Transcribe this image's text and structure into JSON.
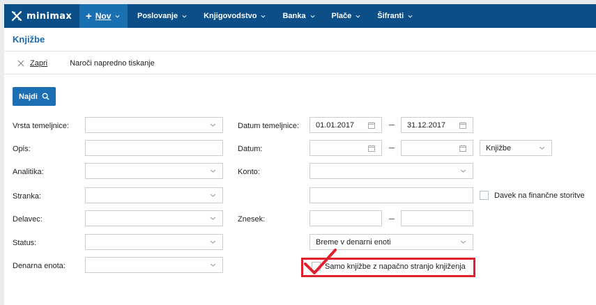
{
  "app": {
    "brand": "minimax",
    "new_label": "Nov",
    "nav": [
      "Poslovanje",
      "Knjigovodstvo",
      "Banka",
      "Plače",
      "Šifranti"
    ]
  },
  "page": {
    "title": "Knjižbe"
  },
  "toolbar": {
    "close_label": "Zapri",
    "print_label": "Naroči napredno tiskanje"
  },
  "search": {
    "find_label": "Najdi"
  },
  "form": {
    "left": [
      {
        "label": "Vrsta temeljnice:",
        "value": ""
      },
      {
        "label": "Opis:",
        "value": ""
      },
      {
        "label": "Analitika:",
        "value": ""
      },
      {
        "label": "Stranka:",
        "value": ""
      },
      {
        "label": "Delavec:",
        "value": ""
      },
      {
        "label": "Status:",
        "value": ""
      },
      {
        "label": "Denarna enota:",
        "value": ""
      }
    ],
    "datum_temeljnice": {
      "label": "Datum temeljnice:",
      "from": "01.01.2017",
      "to": "31.12.2017"
    },
    "datum": {
      "label": "Datum:",
      "from": "",
      "to": "",
      "type_select": "Knjižbe"
    },
    "konto": {
      "label": "Konto:",
      "value": ""
    },
    "konto_extra": {
      "value": ""
    },
    "davek": {
      "label": "Davek na finančne storitve",
      "checked": false
    },
    "znesek": {
      "label": "Znesek:",
      "from": "",
      "to": ""
    },
    "breme": {
      "value": "Breme v denarni enoti"
    },
    "samo": {
      "label": "Samo knjižbe z napačno stranjo knjiženja",
      "checked": false
    }
  },
  "colors": {
    "nav_bg": "#0b4e88",
    "nav_new_bg": "#1a6fb0",
    "title": "#1a6aab",
    "button": "#1c6fb2",
    "highlight": "#e0202a"
  }
}
